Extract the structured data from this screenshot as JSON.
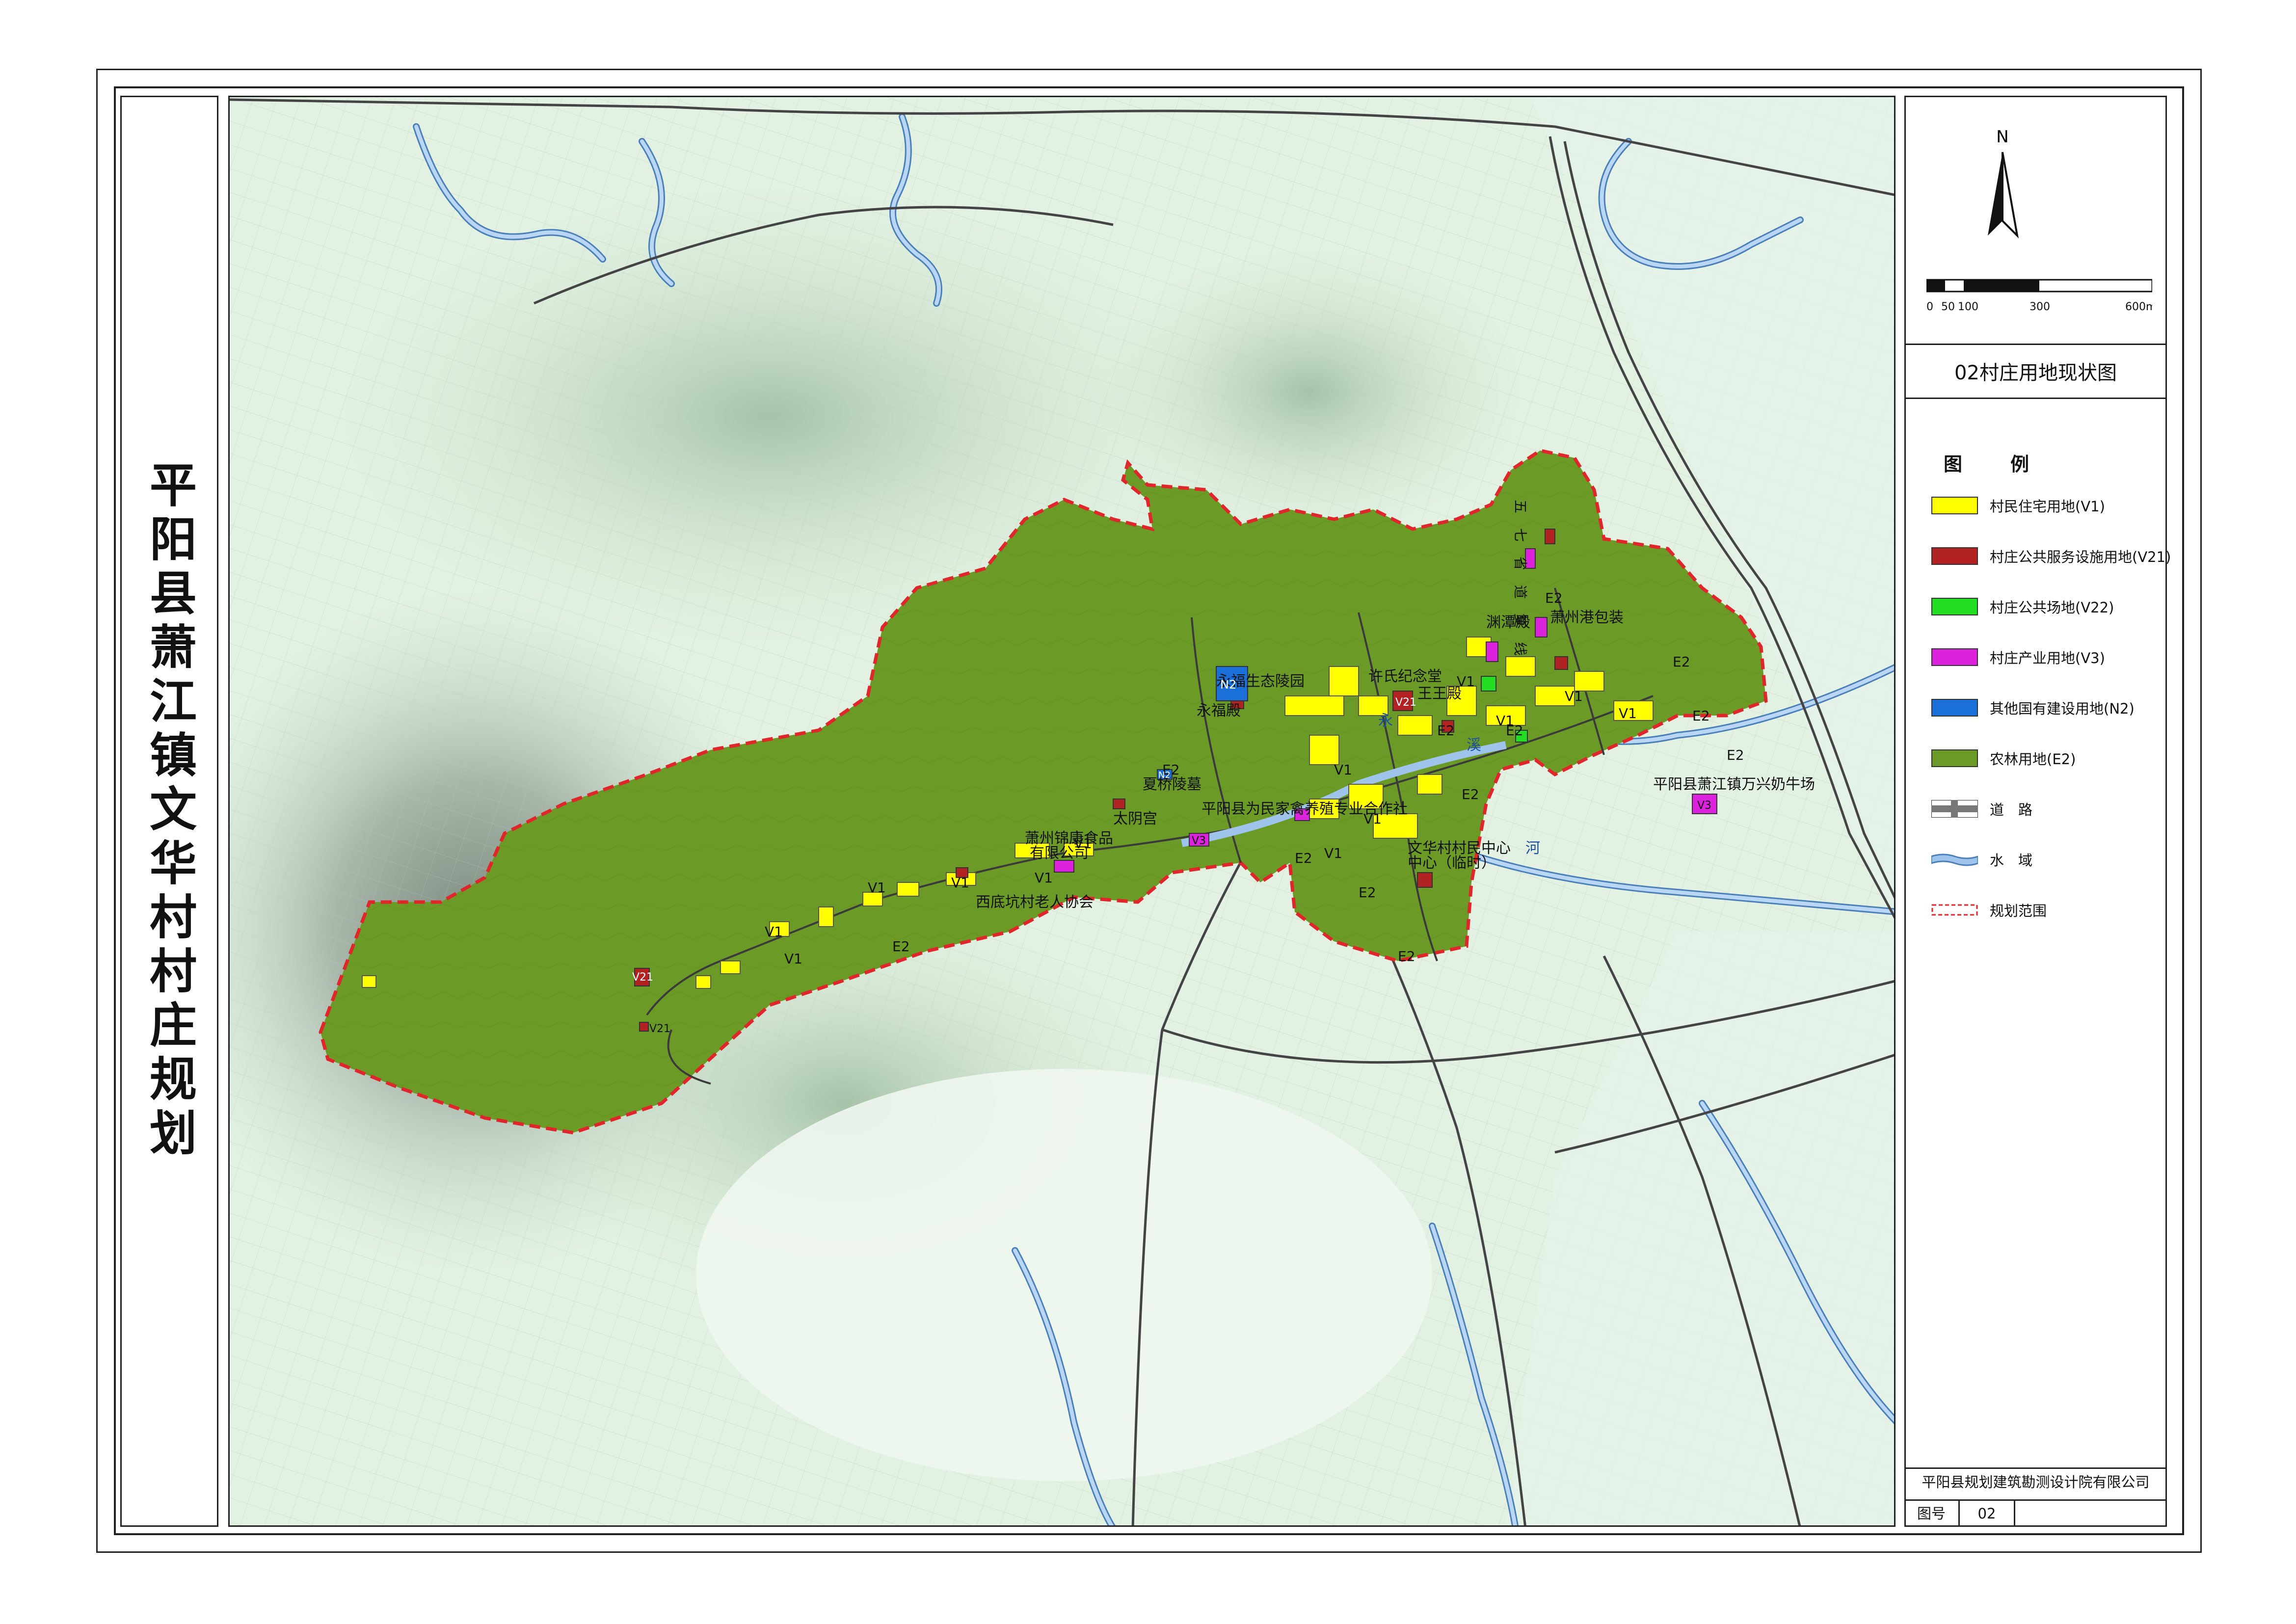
{
  "title": "平阳县萧江镇文华村村庄规划",
  "map_title": "02村庄用地现状图",
  "north_label": "N",
  "scale_bar": {
    "ticks": [
      "0",
      "50",
      "100",
      "300",
      "600m"
    ]
  },
  "legend": {
    "title": "图　例",
    "items": [
      {
        "label": "村民住宅用地(V1)",
        "color": "#ffff00",
        "kind": "fill"
      },
      {
        "label": "村庄公共服务设施用地(V21)",
        "color": "#b22222",
        "kind": "fill"
      },
      {
        "label": "村庄公共场地(V22)",
        "color": "#22dd22",
        "kind": "fill"
      },
      {
        "label": "村庄产业用地(V3)",
        "color": "#dd22dd",
        "kind": "fill"
      },
      {
        "label": "其他国有建设用地(N2)",
        "color": "#1a6fd8",
        "kind": "fill"
      },
      {
        "label": "农林用地(E2)",
        "color": "#6b9a26",
        "kind": "fill"
      },
      {
        "label": "道　路",
        "color": "#555555",
        "kind": "road"
      },
      {
        "label": "水　域",
        "color": "#9ec4ec",
        "kind": "water"
      },
      {
        "label": "规划范围",
        "color": "#e0262b",
        "kind": "boundary"
      }
    ]
  },
  "company": "平阳县规划建筑勘测设计院有限公司",
  "figure_no": {
    "label": "图号",
    "value": "02"
  },
  "colors": {
    "e2": "#6b9a26",
    "v1": "#ffff00",
    "v21": "#b22222",
    "v22": "#22dd22",
    "v3": "#dd22dd",
    "n2": "#1a6fd8",
    "boundary": "#e0262b",
    "water": "#9ec4ec"
  },
  "map_labels": {
    "yongfu_temple": "永福生态陵园",
    "yongfu_hall": "永福殿",
    "xiajiao": "夏桥陵墓",
    "taiyin": "太阴宫",
    "coop": "平阳县为民家禽养殖专业合作社",
    "food_co_1": "萧州锦康食品",
    "food_co_2": "有限公司",
    "elder": "西底坑村老人协会",
    "xu_memorial": "许氏纪念堂",
    "temple_king": "王王殿",
    "temple_east": "渊潭殿",
    "pack": "萧州港包装",
    "village_center": "文华村村民中心",
    "village_center_2": "中心（临时）",
    "dairy": "平阳县萧江镇万兴奶牛场",
    "road_name": "五七省道复线",
    "river_1": "永",
    "river_2": "溪",
    "river_3": "河",
    "e2": "E2",
    "v1": "V1",
    "v21": "V21",
    "v3": "V3",
    "n2": "N2"
  }
}
